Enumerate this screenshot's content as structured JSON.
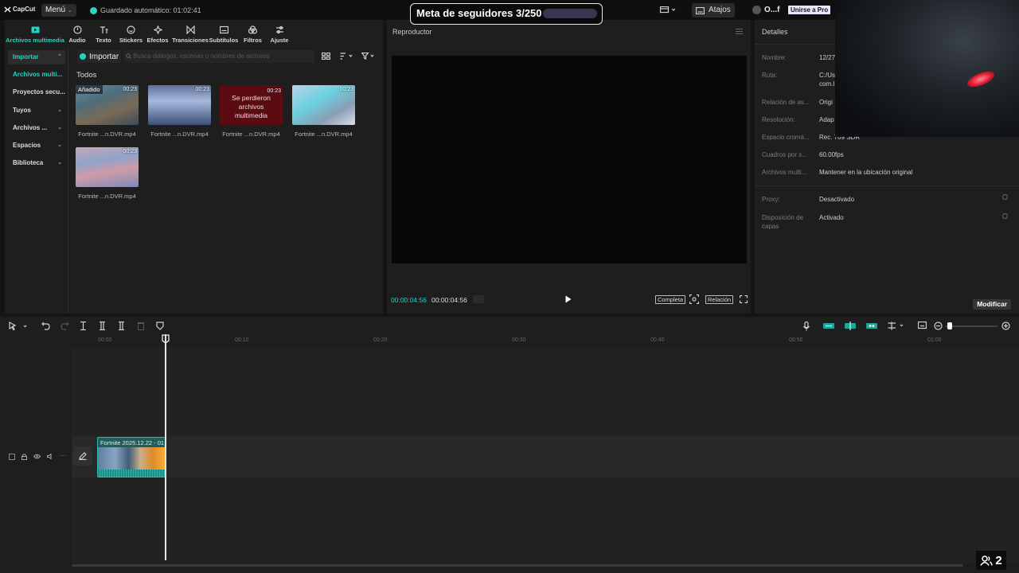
{
  "topbar": {
    "app_name": "CapCut",
    "menu_label": "Menú",
    "autosave_text": "Guardado automático: 01:02:41",
    "shortcuts_label": "Atajos",
    "user_name": "O...f",
    "pro_button": "Unirse a Pro"
  },
  "overlay": {
    "follower_goal": "Meta de seguidores 3/250",
    "viewer_count": "2"
  },
  "tools": [
    {
      "label": "Archivos multimedia",
      "icon": "media-icon",
      "active": true
    },
    {
      "label": "Audio",
      "icon": "audio-icon"
    },
    {
      "label": "Texto",
      "icon": "text-icon"
    },
    {
      "label": "Stickers",
      "icon": "sticker-icon"
    },
    {
      "label": "Efectos",
      "icon": "effects-icon"
    },
    {
      "label": "Transiciones",
      "icon": "transitions-icon"
    },
    {
      "label": "Subtítulos",
      "icon": "subtitles-icon"
    },
    {
      "label": "Filtros",
      "icon": "filters-icon"
    },
    {
      "label": "Ajuste",
      "icon": "adjust-icon"
    }
  ],
  "sidebar": {
    "items": [
      {
        "label": "Importar"
      },
      {
        "label": "Archivos multi..."
      },
      {
        "label": "Proyectos secu..."
      },
      {
        "label": "Tuyos"
      },
      {
        "label": "Archivos ..."
      },
      {
        "label": "Espacios"
      },
      {
        "label": "Biblioteca"
      }
    ]
  },
  "media": {
    "import_label": "Importar",
    "search_placeholder": "Busca diálogos, escenas o nombres de archivos",
    "section_label": "Todos",
    "items": [
      {
        "name": "Fortnite ...n.DVR.mp4",
        "duration": "00:23",
        "badge": "Añadido"
      },
      {
        "name": "Fortnite ...n.DVR.mp4",
        "duration": "00:23"
      },
      {
        "name": "Fortnite ...n.DVR.mp4",
        "duration": "00:23",
        "lost_text": "Se perdieron archivos multimedia"
      },
      {
        "name": "Fortnite ...n.DVR.mp4",
        "duration": "00:23"
      },
      {
        "name": "Fortnite ...n.DVR.mp4",
        "duration": "00:23"
      }
    ]
  },
  "player": {
    "title": "Reproductor",
    "current_time": "00:00:04:56",
    "total_time": "00:00:04:56",
    "full_button": "Completa",
    "ratio_button": "Relación"
  },
  "details": {
    "title": "Detalles",
    "rows": [
      {
        "label": "Nombre:",
        "value": "12/27"
      },
      {
        "label": "Ruta:",
        "value": "C:/Us com.l"
      },
      {
        "label": "Relación de as...",
        "value": "Origi"
      },
      {
        "label": "Resolución:",
        "value": "Adap"
      },
      {
        "label": "Espacio cromá...",
        "value": "Rec. 709 SDR"
      },
      {
        "label": "Cuadros por s...",
        "value": "60.00fps"
      },
      {
        "label": "Archivos multi...",
        "value": "Mantener en la ubicación original"
      },
      {
        "label": "Proxy:",
        "value": "Desactivado"
      },
      {
        "label": "Disposición de capas",
        "value": "Activado"
      }
    ],
    "modify_button": "Modificar"
  },
  "timeline": {
    "ruler_ticks": [
      "00:00",
      "00:10",
      "00:20",
      "00:30",
      "00:40",
      "00:50",
      "01:00"
    ],
    "clip_name": "Fortnite 2025.12.22 - 01"
  }
}
